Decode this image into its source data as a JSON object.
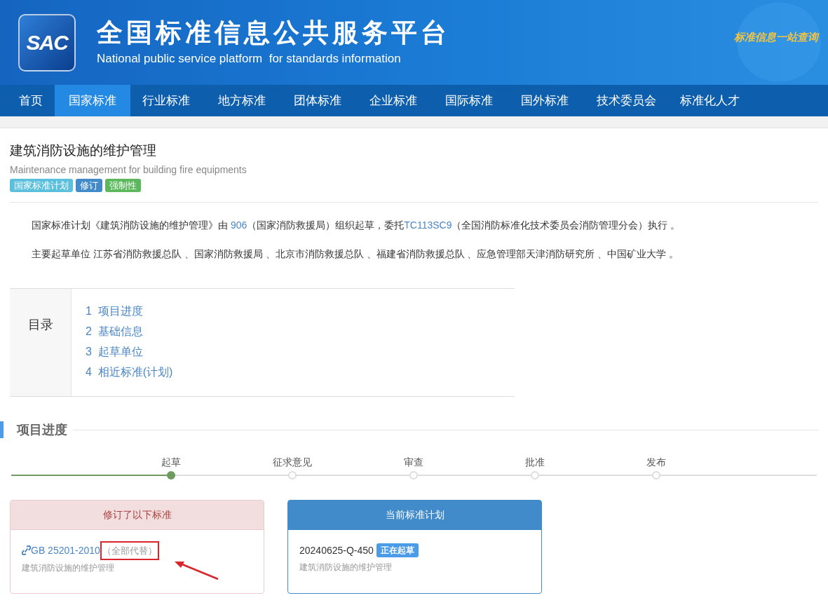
{
  "header": {
    "logo": "SAC",
    "title": "全国标准信息公共服务平台",
    "subtitle": "National public service platform  for standards information",
    "slogan": "标准信息一站查询"
  },
  "nav": [
    {
      "label": "首页",
      "selected": false
    },
    {
      "label": "国家标准",
      "selected": true
    },
    {
      "label": "行业标准",
      "selected": false
    },
    {
      "label": "地方标准",
      "selected": false
    },
    {
      "label": "团体标准",
      "selected": false
    },
    {
      "label": "企业标准",
      "selected": false
    },
    {
      "label": "国际标准",
      "selected": false
    },
    {
      "label": "国外标准",
      "selected": false
    },
    {
      "label": "技术委员会",
      "selected": false
    },
    {
      "label": "标准化人才",
      "selected": false
    }
  ],
  "title": "建筑消防设施的维护管理",
  "title_en": "Maintenance management for building fire equipments",
  "tags": [
    {
      "label": "国家标准计划",
      "color": "#5bc0de"
    },
    {
      "label": "修订",
      "color": "#428bca"
    },
    {
      "label": "强制性",
      "color": "#5cb85c"
    }
  ],
  "summary": [
    {
      "kind": "text",
      "text": "国家标准计划《建筑消防设施的维护管理》由 "
    },
    {
      "kind": "link",
      "text": "906"
    },
    {
      "kind": "text",
      "text": "（国家消防救援局）组织起草，委托"
    },
    {
      "kind": "link",
      "text": "TC113SC9"
    },
    {
      "kind": "text",
      "text": "（全国消防标准化技术委员会消防管理分会）执行 。"
    }
  ],
  "drafters": "主要起草单位 江苏省消防救援总队 、国家消防救援局 、北京市消防救援总队 、福建省消防救援总队 、应急管理部天津消防研究所 、中国矿业大学 。",
  "toc": {
    "title": "目录",
    "items": [
      "1  项目进度",
      "2  基础信息",
      "3  起草单位",
      "4  相近标准(计划)"
    ]
  },
  "progress": {
    "title": "项目进度",
    "steps": [
      {
        "label": "起草",
        "selected": true
      },
      {
        "label": "征求意见",
        "selected": false
      },
      {
        "label": "审查",
        "selected": false
      },
      {
        "label": "批准",
        "selected": false
      },
      {
        "label": "发布",
        "selected": false
      }
    ]
  },
  "revised": {
    "title": "修订了以下标准",
    "code": "GB 25201-2010",
    "note": "（全部代替）",
    "name": "建筑消防设施的维护管理",
    "highlighted": true
  },
  "current": {
    "title": "当前标准计划",
    "code": "20240625-Q-450",
    "status": "正在起草",
    "name": "建筑消防设施的维护管理"
  }
}
